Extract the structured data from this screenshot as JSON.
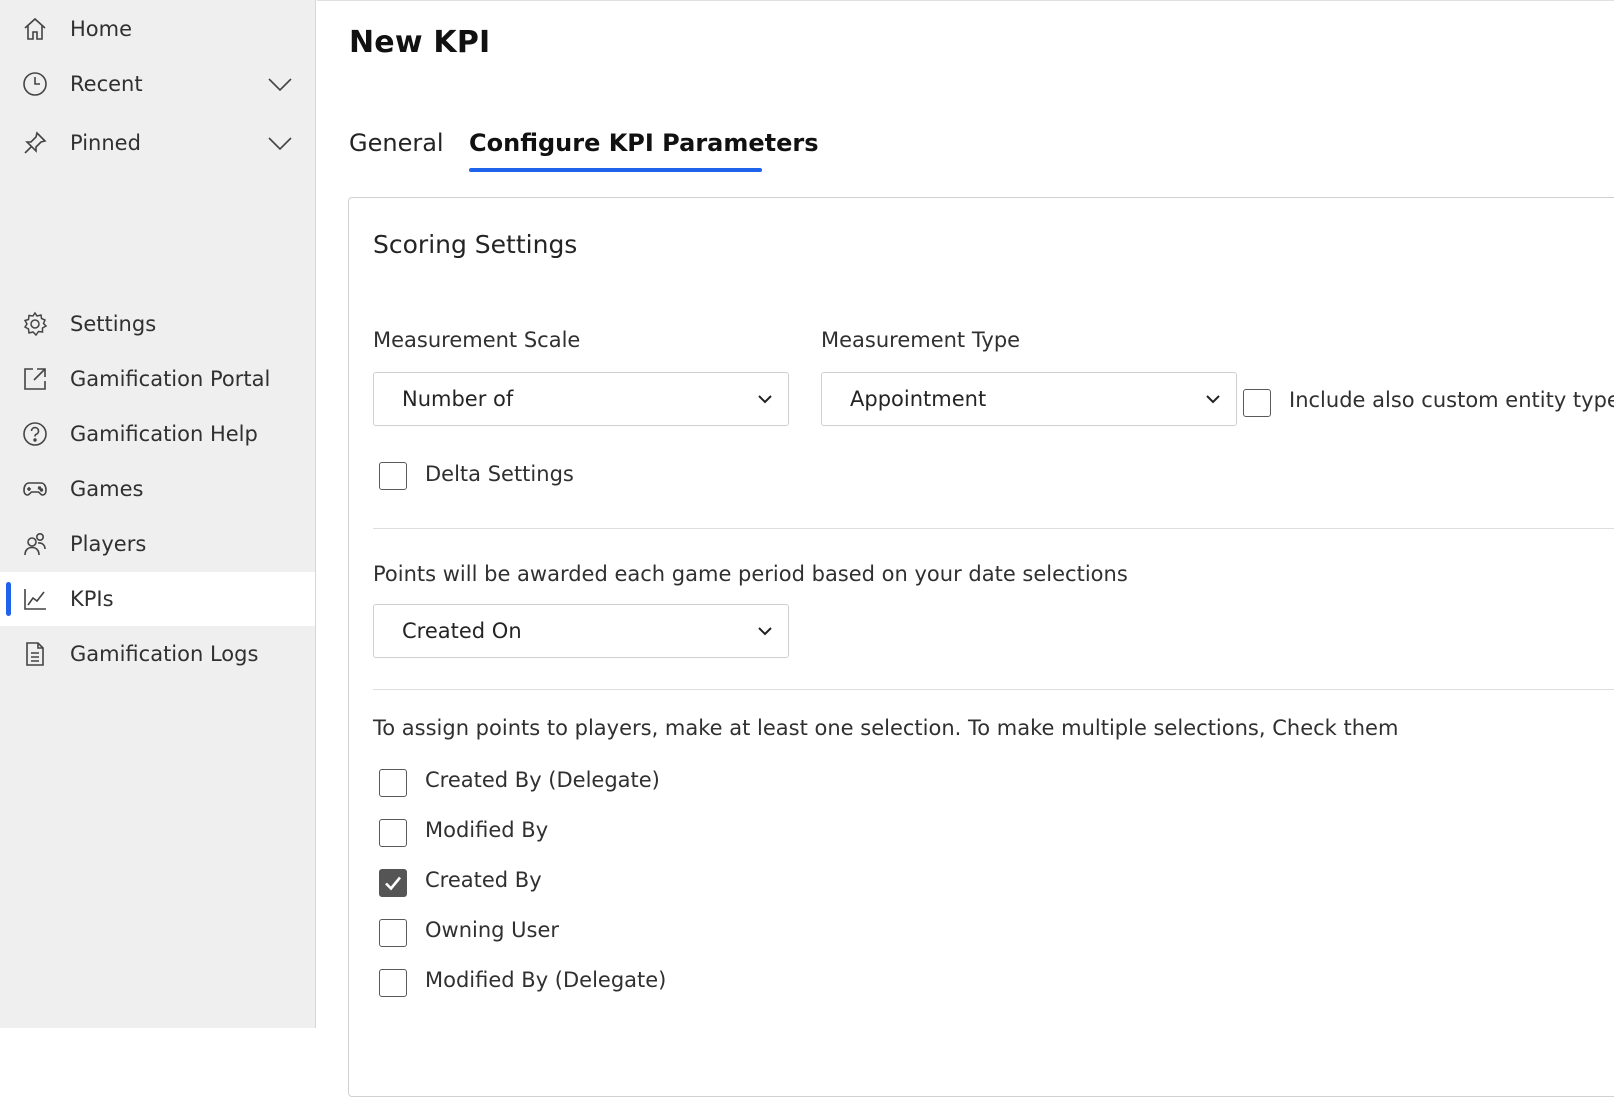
{
  "sidebar": {
    "items": [
      {
        "label": "Home",
        "icon": "home-icon"
      },
      {
        "label": "Recent",
        "icon": "clock-icon",
        "expandable": true
      },
      {
        "label": "Pinned",
        "icon": "pin-icon",
        "expandable": true
      },
      {
        "label": "Settings",
        "icon": "gear-icon"
      },
      {
        "label": "Gamification Portal",
        "icon": "external-link-icon"
      },
      {
        "label": "Gamification Help",
        "icon": "help-circle-icon"
      },
      {
        "label": "Games",
        "icon": "gamepad-icon"
      },
      {
        "label": "Players",
        "icon": "people-icon"
      },
      {
        "label": "KPIs",
        "icon": "line-chart-icon",
        "active": true
      },
      {
        "label": "Gamification Logs",
        "icon": "document-icon"
      }
    ]
  },
  "main": {
    "title": "New KPI",
    "tabs": [
      {
        "label": "General",
        "selected": false
      },
      {
        "label": "Configure KPI Parameters",
        "selected": true
      }
    ],
    "card": {
      "section_title": "Scoring Settings",
      "measurement_scale": {
        "label": "Measurement Scale",
        "value": "Number of"
      },
      "measurement_type": {
        "label": "Measurement Type",
        "value": "Appointment"
      },
      "include_custom": {
        "label": "Include also custom entity types",
        "checked": false
      },
      "delta_settings": {
        "label": "Delta Settings",
        "checked": false
      },
      "date_section": {
        "label": "Points will be awarded each game period based on your date selections",
        "value": "Created On"
      },
      "assign_section": {
        "label": "To assign points to players, make at least one selection. To make multiple selections, Check them",
        "options": [
          {
            "label": "Created By (Delegate)",
            "checked": false
          },
          {
            "label": "Modified By",
            "checked": false
          },
          {
            "label": "Created By",
            "checked": true
          },
          {
            "label": "Owning User",
            "checked": false
          },
          {
            "label": "Modified By (Delegate)",
            "checked": false
          }
        ]
      }
    }
  },
  "colors": {
    "accent": "#1e63e9",
    "sidebar_bg": "#efefef",
    "checked_fill": "#555555"
  }
}
